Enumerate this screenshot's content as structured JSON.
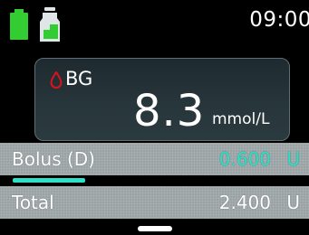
{
  "status": {
    "time": "09:00",
    "battery_icon": "battery-icon",
    "reservoir_icon": "reservoir-icon",
    "accent_color": "#33cc33"
  },
  "bg": {
    "label": "BG",
    "value": "8.3",
    "unit": "mmol/L",
    "icon": "blood-drop-icon",
    "icon_color": "#e0101a"
  },
  "bolus": {
    "label": "Bolus (D)",
    "value": "0.600",
    "unit": "U",
    "color": "#2ee0c8",
    "progress": 0.25
  },
  "total": {
    "label": "Total",
    "value": "2.400",
    "unit": "U"
  }
}
